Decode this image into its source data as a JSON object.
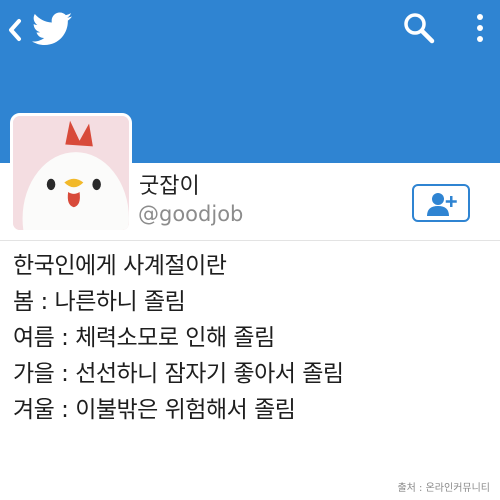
{
  "profile": {
    "display_name": "굿잡이",
    "handle": "@goodjob"
  },
  "tweet": {
    "lines": [
      "한국인에게 사계절이란",
      "봄 : 나른하니 졸림",
      "여름 : 체력소모로 인해 졸림",
      "가을 : 선선하니 잠자기 좋아서 졸림",
      "겨울 : 이불밖은 위험해서 졸림"
    ]
  },
  "source": "출처 : 온라인커뮤니티",
  "colors": {
    "header_bg": "#2f84d2",
    "accent": "#2f84d2",
    "handle_gray": "#8c8c8c"
  },
  "icons": [
    "back-icon",
    "twitter-bird-icon",
    "search-icon",
    "more-icon",
    "add-user-icon"
  ]
}
